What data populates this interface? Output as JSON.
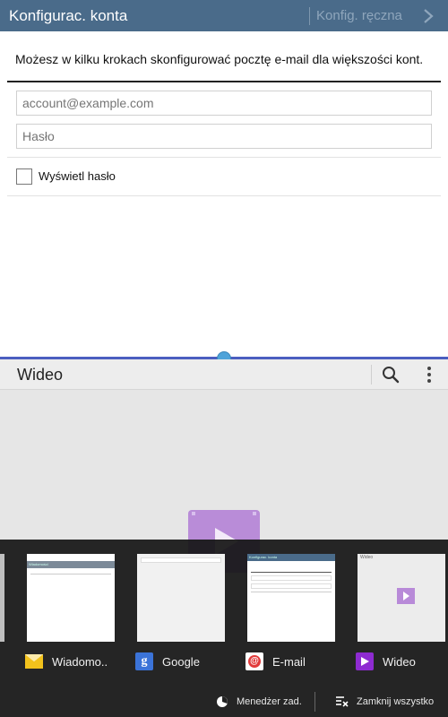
{
  "email_setup": {
    "title": "Konfigurac. konta",
    "manual_label": "Konfig. ręczna",
    "intro": "Możesz w kilku krokach skonfigurować pocztę e-mail dla większości kont.",
    "email_placeholder": "account@example.com",
    "password_placeholder": "Hasło",
    "show_password_label": "Wyświetl hasło",
    "show_password_checked": false
  },
  "video_app": {
    "title": "Wideo"
  },
  "recents": {
    "apps": [
      {
        "label": "Wiadomo..",
        "icon": "envelope-icon",
        "thumb_title": "Wiadomości"
      },
      {
        "label": "Google",
        "icon": "google-icon"
      },
      {
        "label": "E-mail",
        "icon": "email-at-icon",
        "thumb_title": "Konfigurac. konta"
      },
      {
        "label": "Wideo",
        "icon": "video-play-icon",
        "thumb_title": "Wideo"
      }
    ],
    "task_manager_label": "Menedżer zad.",
    "close_all_label": "Zamknij wszystko"
  },
  "colors": {
    "actionbar": "#4a6b8a",
    "split_line": "#4b5ec0",
    "split_handle": "#4fa3d9",
    "video_accent": "#8e2bd1"
  }
}
